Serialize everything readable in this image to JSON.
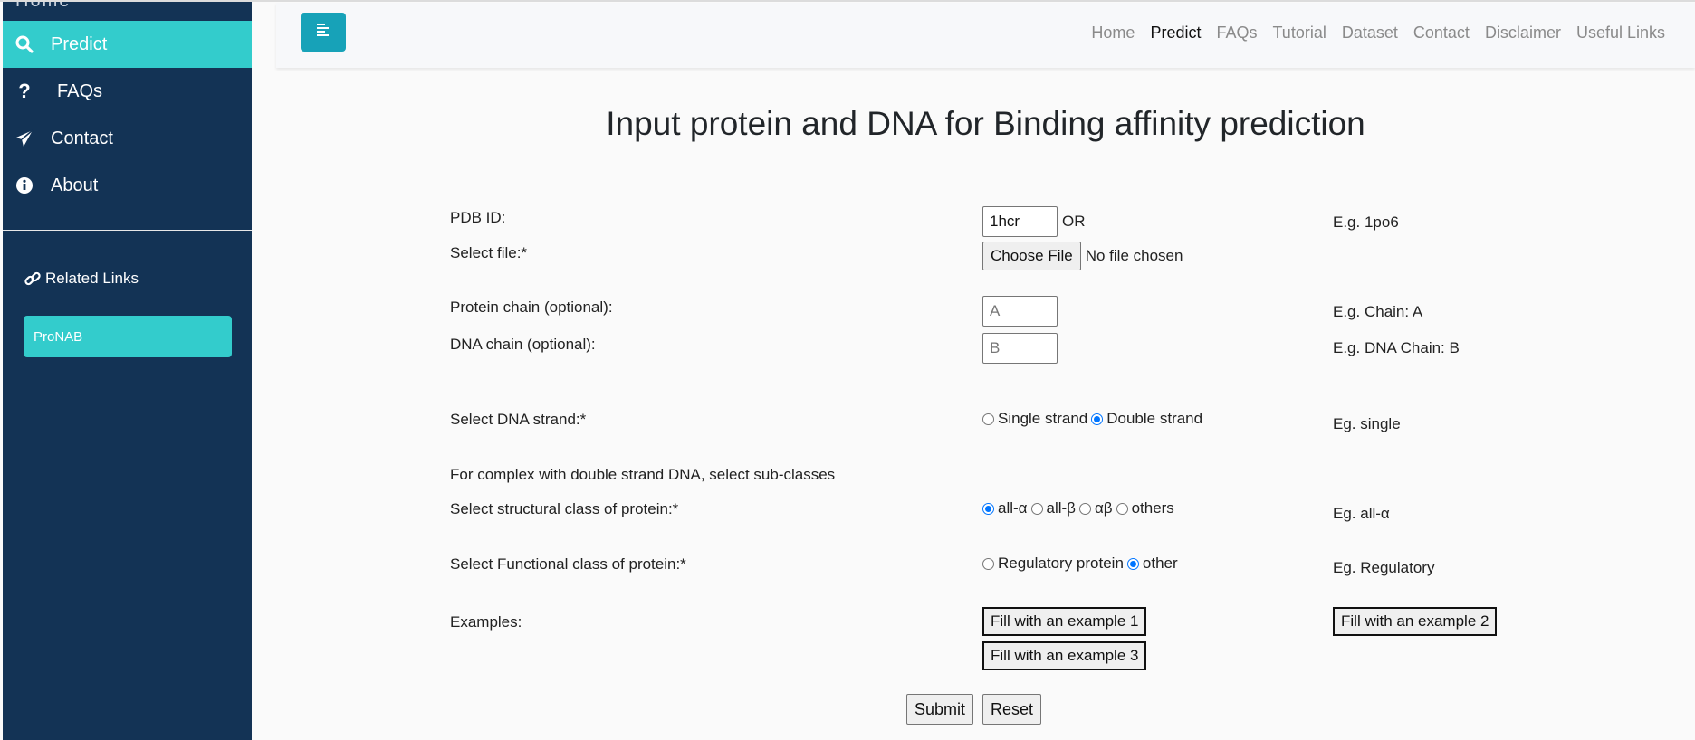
{
  "sidebar": {
    "partial_item": "Home",
    "items": [
      {
        "label": "Predict",
        "icon": "search-icon",
        "active": true
      },
      {
        "label": "FAQs",
        "icon": "question-icon",
        "active": false
      },
      {
        "label": "Contact",
        "icon": "paper-plane-icon",
        "active": false
      },
      {
        "label": "About",
        "icon": "info-circle-icon",
        "active": false
      }
    ],
    "related_links_title": "Related Links",
    "related_links": [
      {
        "label": "ProNAB"
      }
    ]
  },
  "navbar": {
    "toggle_icon": "menu-toggle-icon",
    "links": [
      {
        "label": "Home",
        "active": false
      },
      {
        "label": "Predict",
        "active": true
      },
      {
        "label": "FAQs",
        "active": false
      },
      {
        "label": "Tutorial",
        "active": false
      },
      {
        "label": "Dataset",
        "active": false
      },
      {
        "label": "Contact",
        "active": false
      },
      {
        "label": "Disclaimer",
        "active": false
      },
      {
        "label": "Useful Links",
        "active": false
      }
    ]
  },
  "form": {
    "title": "Input protein and DNA for Binding affinity prediction",
    "pdb_id": {
      "label": "PDB ID:",
      "value": "1hcr",
      "or_text": "OR",
      "example": "E.g. 1po6"
    },
    "file": {
      "label": "Select file:*",
      "button": "Choose File",
      "status": "No file chosen"
    },
    "protein_chain": {
      "label": "Protein chain (optional):",
      "placeholder": "A",
      "value": "",
      "example": "E.g. Chain: A"
    },
    "dna_chain": {
      "label": "DNA chain (optional):",
      "placeholder": "B",
      "value": "",
      "example": "E.g. DNA Chain: B"
    },
    "dna_strand": {
      "label": "Select DNA strand:*",
      "options": [
        {
          "label": "Single strand",
          "checked": false
        },
        {
          "label": "Double strand",
          "checked": true
        }
      ],
      "example": "Eg. single"
    },
    "subclass_note": "For complex with double strand DNA, select sub-classes",
    "structural_class": {
      "label": "Select structural class of protein:*",
      "options": [
        {
          "label": "all-α",
          "checked": true
        },
        {
          "label": "all-β",
          "checked": false
        },
        {
          "label": "αβ",
          "checked": false
        },
        {
          "label": "others",
          "checked": false
        }
      ],
      "example": "Eg. all-α"
    },
    "functional_class": {
      "label": "Select Functional class of protein:*",
      "options": [
        {
          "label": "Regulatory protein",
          "checked": false
        },
        {
          "label": "other",
          "checked": true
        }
      ],
      "example": "Eg. Regulatory"
    },
    "examples": {
      "label": "Examples:",
      "buttons": [
        "Fill with an example 1",
        "Fill with an example 2",
        "Fill with an example 3"
      ]
    },
    "submit_label": "Submit",
    "reset_label": "Reset"
  }
}
